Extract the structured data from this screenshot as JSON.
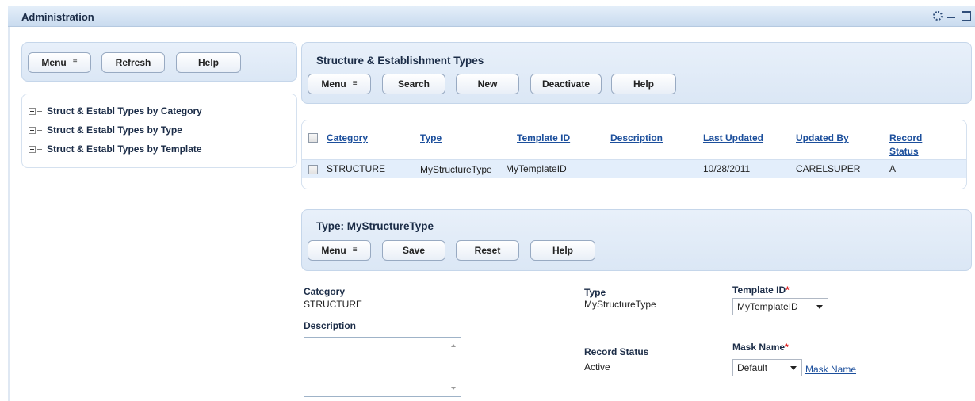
{
  "window": {
    "title": "Administration"
  },
  "left_panel": {
    "buttons": {
      "menu": "Menu",
      "refresh": "Refresh",
      "help": "Help"
    },
    "tree": [
      {
        "label": "Struct & Establ Types by Category"
      },
      {
        "label": "Struct & Establ Types by Type"
      },
      {
        "label": "Struct & Establ Types by Template"
      }
    ]
  },
  "list_panel": {
    "title": "Structure & Establishment Types",
    "buttons": {
      "menu": "Menu",
      "search": "Search",
      "new": "New",
      "deactivate": "Deactivate",
      "help": "Help"
    }
  },
  "table": {
    "columns": [
      "Category",
      "Type",
      "Template ID",
      "Description",
      "Last Updated",
      "Updated By",
      "Record",
      "Status"
    ],
    "rows": [
      {
        "category": "STRUCTURE",
        "type": "MyStructureType",
        "template_id": "MyTemplateID",
        "description": "",
        "last_updated": "10/28/2011",
        "updated_by": "CARELSUPER",
        "record_status": "A"
      }
    ]
  },
  "detail_panel": {
    "title": "Type: MyStructureType",
    "buttons": {
      "menu": "Menu",
      "save": "Save",
      "reset": "Reset",
      "help": "Help"
    }
  },
  "form": {
    "category_label": "Category",
    "category_value": "STRUCTURE",
    "description_label": "Description",
    "description_value": "",
    "type_label": "Type",
    "type_value": "MyStructureType",
    "record_status_label": "Record Status",
    "record_status_value": "Active",
    "template_id_label": "Template ID",
    "template_id_value": "MyTemplateID",
    "mask_name_label": "Mask Name",
    "mask_name_value": "Default",
    "mask_name_link": "Mask Name",
    "required_marker": "*"
  },
  "colors": {
    "link": "#1c4f9c",
    "required": "#e02020",
    "panel": "#dbe7f5"
  }
}
